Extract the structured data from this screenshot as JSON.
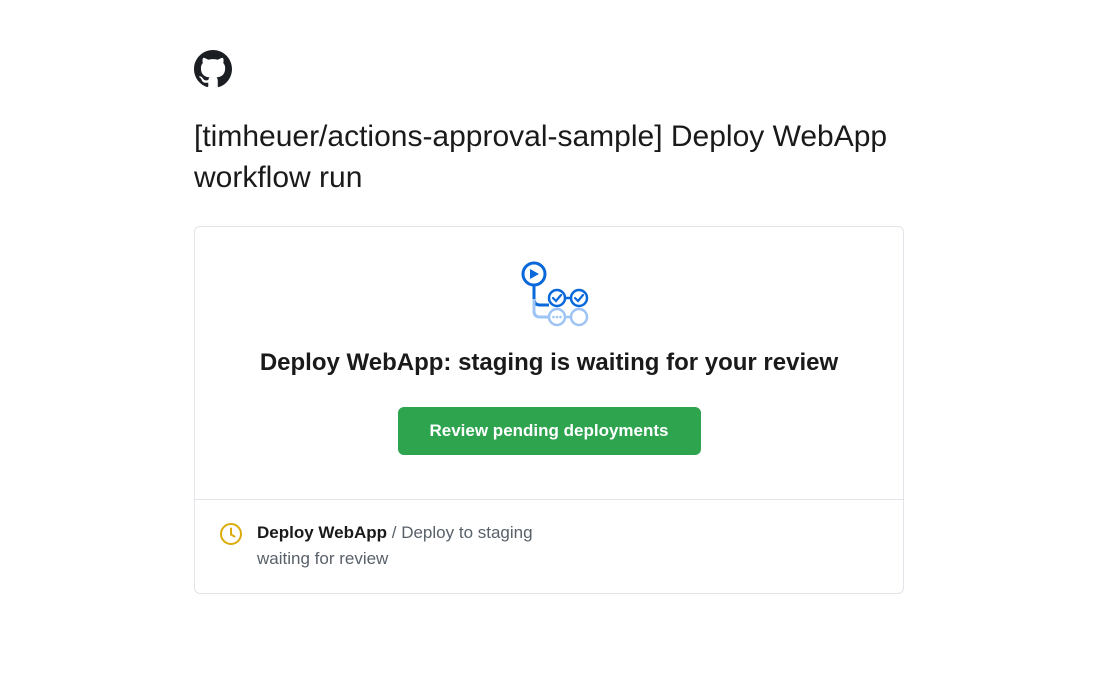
{
  "title": "[timheuer/actions-approval-sample] Deploy WebApp workflow run",
  "card": {
    "heading": "Deploy WebApp: staging is waiting for your review",
    "button_label": "Review pending deployments"
  },
  "footer": {
    "workflow_name": "Deploy WebApp",
    "separator": " / ",
    "job_name": "Deploy to staging",
    "status": "waiting for review"
  },
  "colors": {
    "button": "#2ea44f",
    "clock": "#dbab09",
    "workflow_blue": "#0969da",
    "workflow_light": "#9ec4f5"
  }
}
